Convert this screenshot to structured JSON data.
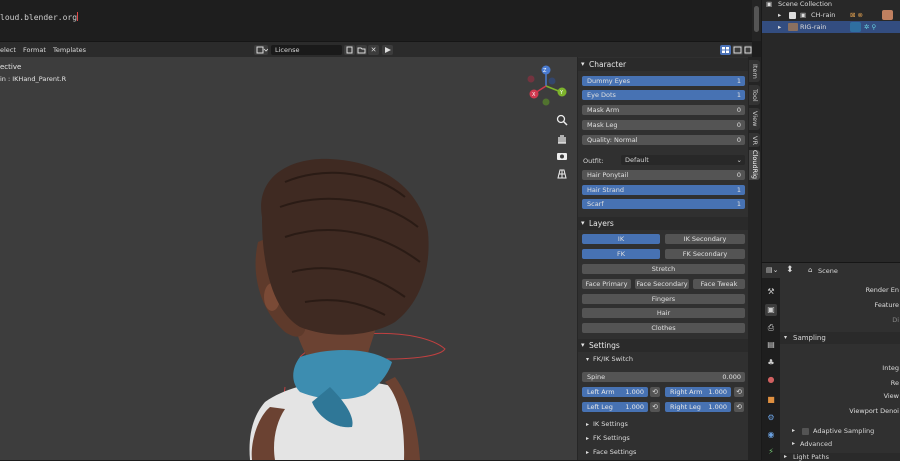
{
  "text_editor": {
    "line": "loud.blender.org"
  },
  "header": {
    "menus": [
      "elect",
      "Format",
      "Templates"
    ],
    "document_name": "License"
  },
  "viewport": {
    "mode": "ective",
    "active_bone": "in : IKHand_Parent.R"
  },
  "npanel": {
    "tabs": [
      "Item",
      "Tool",
      "View",
      "VR",
      "CloudRig"
    ],
    "active_tab": "CloudRig",
    "character": {
      "title": "Character",
      "props": [
        {
          "label": "Dummy Eyes",
          "value": "1",
          "on": true
        },
        {
          "label": "Eye Dots",
          "value": "1",
          "on": true
        },
        {
          "label": "Mask Arm",
          "value": "0",
          "on": false
        },
        {
          "label": "Mask Leg",
          "value": "0",
          "on": false
        },
        {
          "label": "Quality: Normal",
          "value": "0",
          "on": false
        }
      ],
      "outfit_label": "Outfit:",
      "outfit_value": "Default",
      "props2": [
        {
          "label": "Hair Ponytail",
          "value": "0",
          "on": false
        },
        {
          "label": "Hair Strand",
          "value": "1",
          "on": true
        },
        {
          "label": "Scarf",
          "value": "1",
          "on": true
        }
      ]
    },
    "layers": {
      "title": "Layers",
      "ik": "IK",
      "ik_secondary": "IK Secondary",
      "fk": "FK",
      "fk_secondary": "FK Secondary",
      "stretch": "Stretch",
      "face_primary": "Face Primary",
      "face_secondary": "Face Secondary",
      "face_tweak": "Face Tweak",
      "fingers": "Fingers",
      "hair": "Hair",
      "clothes": "Clothes"
    },
    "settings": {
      "title": "Settings",
      "fkik_switch": "FK/IK Switch",
      "spine": {
        "label": "Spine",
        "value": "0.000"
      },
      "left_arm": {
        "label": "Left Arm",
        "value": "1.000"
      },
      "right_arm": {
        "label": "Right Arm",
        "value": "1.000"
      },
      "left_leg": {
        "label": "Left Leg",
        "value": "1.000"
      },
      "right_leg": {
        "label": "Right Leg",
        "value": "1.000"
      },
      "ik_settings": "IK Settings",
      "fk_settings": "FK Settings",
      "face_settings": "Face Settings"
    }
  },
  "outliner": {
    "scene_collection": "Scene Collection",
    "items": [
      "CH-rain",
      "RIG-rain"
    ]
  },
  "properties": {
    "scene": "Scene",
    "render_engine": "Render En",
    "feature": "Feature",
    "dis": "Di",
    "sampling": "Sampling",
    "integ": "Integ",
    "re": "Re",
    "view": "View",
    "viewport_denoi": "Viewport Denoi",
    "adaptive_sampling": "Adaptive Sampling",
    "advanced": "Advanced",
    "light_paths": "Light Paths"
  },
  "colors": {
    "accent": "#4772b3",
    "selection": "#334d80"
  }
}
